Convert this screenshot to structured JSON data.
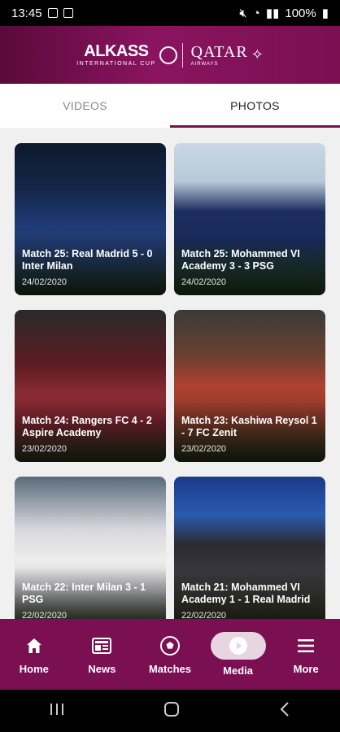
{
  "status_bar": {
    "time": "13:45",
    "battery": "100%"
  },
  "header": {
    "brand_main": "ALKASS",
    "brand_sub": "INTERNATIONAL CUP",
    "sponsor_main": "QATAR",
    "sponsor_sub": "AIRWAYS"
  },
  "tabs": [
    {
      "label": "VIDEOS",
      "active": false
    },
    {
      "label": "PHOTOS",
      "active": true
    }
  ],
  "photos": [
    {
      "title": "Match 25: Real Madrid 5 - 0 Inter Milan",
      "date": "24/02/2020"
    },
    {
      "title": "Match 25: Mohammed VI Academy 3 - 3 PSG",
      "date": "24/02/2020"
    },
    {
      "title": "Match 24: Rangers FC 4 - 2 Aspire Academy",
      "date": "23/02/2020"
    },
    {
      "title": "Match 23: Kashiwa Reysol 1 - 7 FC Zenit",
      "date": "23/02/2020"
    },
    {
      "title": "Match 22: Inter Milan 3 - 1 PSG",
      "date": "22/02/2020"
    },
    {
      "title": "Match 21: Mohammed VI Academy 1 - 1 Real Madrid",
      "date": "22/02/2020"
    }
  ],
  "bottom_nav": [
    {
      "label": "Home",
      "icon": "home-icon"
    },
    {
      "label": "News",
      "icon": "news-icon"
    },
    {
      "label": "Matches",
      "icon": "soccer-ball-icon"
    },
    {
      "label": "Media",
      "icon": "play-icon",
      "active": true
    },
    {
      "label": "More",
      "icon": "menu-icon"
    }
  ],
  "colors": {
    "brand": "#7a0f52",
    "active_pill": "#e8d5e2"
  }
}
